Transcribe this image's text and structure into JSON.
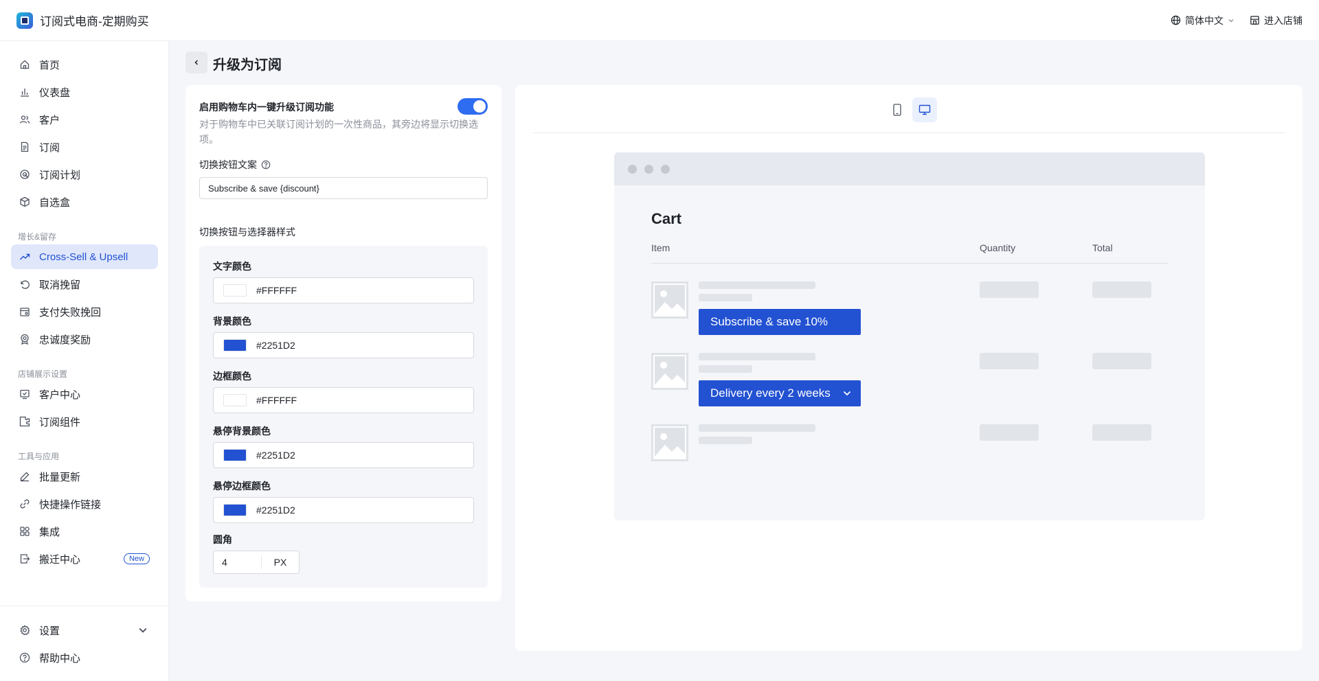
{
  "header": {
    "app_title": "订阅式电商-定期购买",
    "language": "简体中文",
    "enter_store": "进入店铺"
  },
  "sidebar": {
    "items": [
      {
        "label": "首页",
        "icon": "home-icon"
      },
      {
        "label": "仪表盘",
        "icon": "bar-chart-icon"
      },
      {
        "label": "客户",
        "icon": "users-icon"
      },
      {
        "label": "订阅",
        "icon": "document-icon"
      },
      {
        "label": "订阅计划",
        "icon": "plan-icon"
      },
      {
        "label": "自选盒",
        "icon": "box-icon"
      }
    ],
    "section_growth": "增长&留存",
    "growth_items": [
      {
        "label": "Cross-Sell & Upsell",
        "icon": "trend-up-icon",
        "active": true
      },
      {
        "label": "取消挽留",
        "icon": "undo-icon"
      },
      {
        "label": "支付失败挽回",
        "icon": "payment-icon"
      },
      {
        "label": "忠诚度奖励",
        "icon": "award-icon"
      }
    ],
    "section_store": "店铺展示设置",
    "store_items": [
      {
        "label": "客户中心",
        "icon": "customer-center-icon"
      },
      {
        "label": "订阅组件",
        "icon": "widget-icon"
      }
    ],
    "section_tools": "工具与应用",
    "tools_items": [
      {
        "label": "批量更新",
        "icon": "edit-icon"
      },
      {
        "label": "快捷操作链接",
        "icon": "link-icon"
      },
      {
        "label": "集成",
        "icon": "apps-icon"
      },
      {
        "label": "搬迁中心",
        "icon": "migrate-icon",
        "badge": "New"
      }
    ],
    "settings": "设置",
    "help": "帮助中心"
  },
  "page": {
    "title": "升级为订阅"
  },
  "settings": {
    "toggle_label": "启用购物车内一键升级订阅功能",
    "toggle_on": true,
    "toggle_desc": "对于购物车中已关联订阅计划的一次性商品，其旁边将显示切换选项。",
    "button_text_label": "切换按钮文案",
    "button_text_value": "Subscribe & save {discount}",
    "style_heading": "切换按钮与选择器样式",
    "fields": [
      {
        "label": "文字颜色",
        "value": "#FFFFFF",
        "swatch": "#FFFFFF"
      },
      {
        "label": "背景颜色",
        "value": "#2251D2",
        "swatch": "#2251D2"
      },
      {
        "label": "边框颜色",
        "value": "#FFFFFF",
        "swatch": "#FFFFFF"
      },
      {
        "label": "悬停背景颜色",
        "value": "#2251D2",
        "swatch": "#2251D2"
      },
      {
        "label": "悬停边框颜色",
        "value": "#2251D2",
        "swatch": "#2251D2"
      }
    ],
    "radius_label": "圆角",
    "radius_value": "4",
    "radius_unit": "PX"
  },
  "preview": {
    "device_selected": "desktop",
    "cart_title": "Cart",
    "col_item": "Item",
    "col_quantity": "Quantity",
    "col_total": "Total",
    "subscribe_button": "Subscribe & save 10%",
    "delivery_select": "Delivery every 2 weeks"
  },
  "colors": {
    "accent": "#2251D2",
    "toggle": "#2E6CF0",
    "active_nav_bg": "#E0E7FB"
  }
}
